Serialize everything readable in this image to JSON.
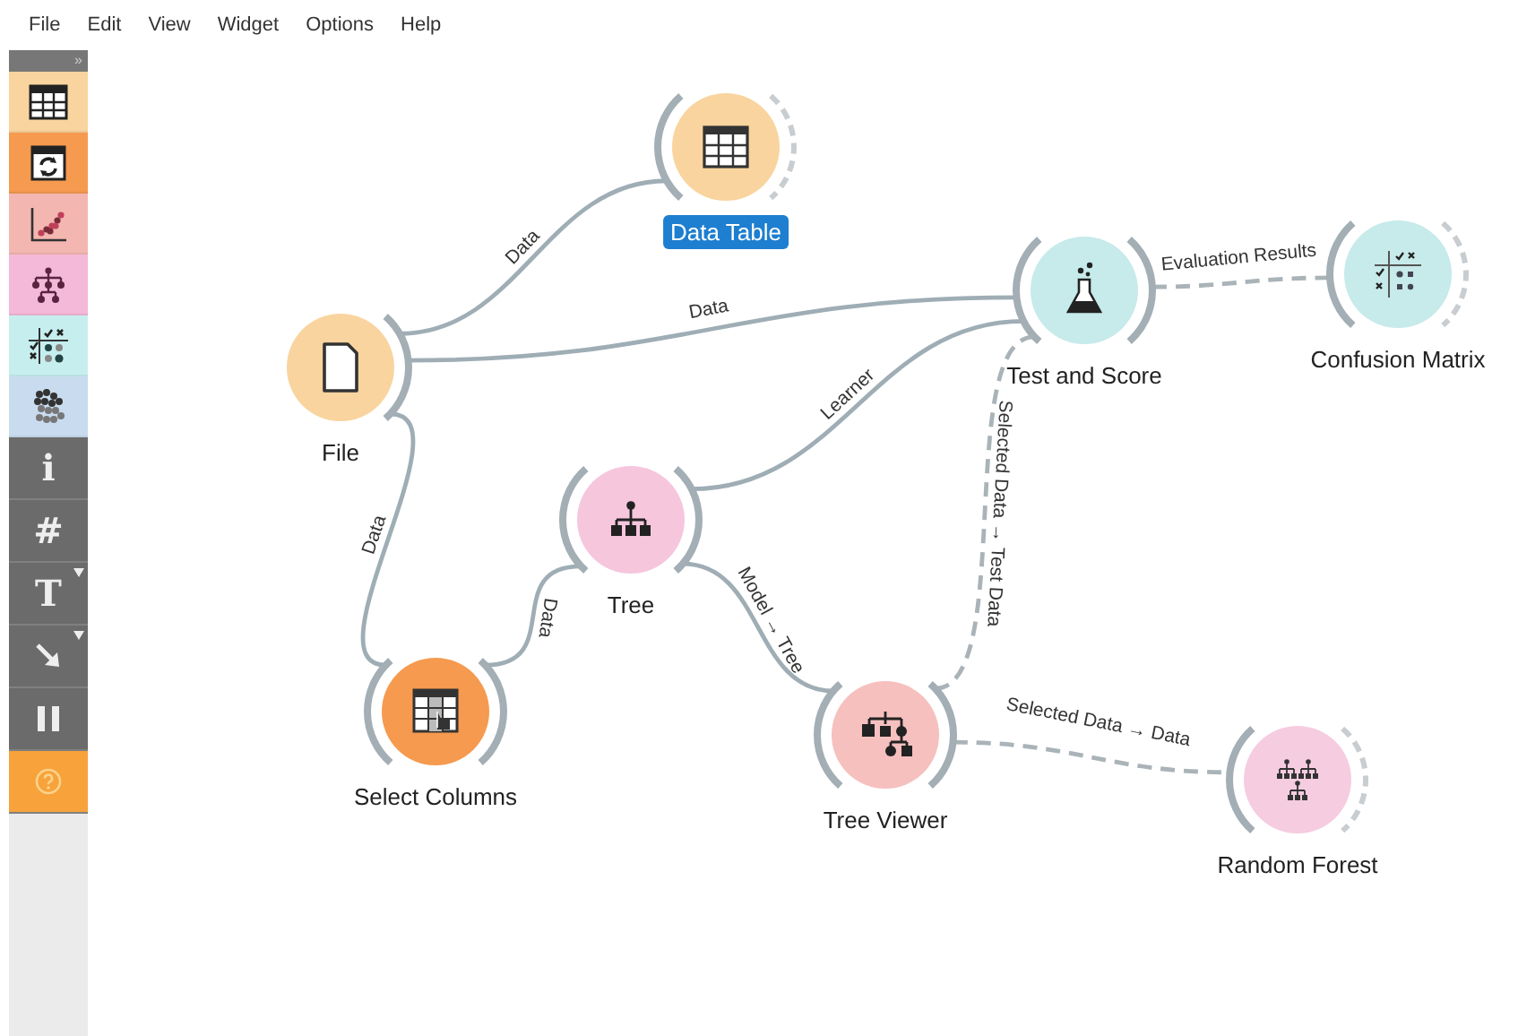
{
  "menu": [
    "File",
    "Edit",
    "View",
    "Widget",
    "Options",
    "Help"
  ],
  "toolbox": {
    "collapse": "»",
    "categories": [
      {
        "kind": "table",
        "color": "#f9d49e"
      },
      {
        "kind": "sync",
        "color": "#f59a4f"
      },
      {
        "kind": "scatter",
        "color": "#f3b6b0"
      },
      {
        "kind": "tree",
        "color": "#f4b8d8"
      },
      {
        "kind": "matrix",
        "color": "#c7eeee"
      },
      {
        "kind": "clusters",
        "color": "#c9dcef"
      }
    ],
    "tools": [
      {
        "kind": "text",
        "label": "i",
        "has_menu": false
      },
      {
        "kind": "text",
        "label": "#",
        "has_menu": false
      },
      {
        "kind": "text",
        "label": "T",
        "has_menu": true
      },
      {
        "kind": "arrow",
        "has_menu": true
      },
      {
        "kind": "pause",
        "has_menu": false
      },
      {
        "kind": "help",
        "has_menu": false
      }
    ]
  },
  "nodes": [
    {
      "title": "Data Table",
      "kind": "table",
      "color": "#f9d49e",
      "selected": true,
      "has_inputs": true
    },
    {
      "title": "File",
      "kind": "file",
      "color": "#f9d49e",
      "selected": false,
      "has_inputs": false
    },
    {
      "title": "Test and Score",
      "kind": "flask",
      "color": "#c7eaea",
      "selected": false,
      "has_inputs": true
    },
    {
      "title": "Confusion Matrix",
      "kind": "matrix",
      "color": "#c7eaea",
      "selected": false,
      "has_inputs": true
    },
    {
      "title": "Tree",
      "kind": "tree",
      "color": "#f6c6dd",
      "selected": false,
      "has_inputs": true
    },
    {
      "title": "Select Columns",
      "kind": "select",
      "color": "#f59a4f",
      "selected": false,
      "has_inputs": true
    },
    {
      "title": "Tree Viewer",
      "kind": "treeviewer",
      "color": "#f6c0bf",
      "selected": false,
      "has_inputs": true
    },
    {
      "title": "Random Forest",
      "kind": "forest",
      "color": "#f5cce0",
      "selected": false,
      "has_inputs": true
    }
  ],
  "links": [
    {
      "label": "Data",
      "dashed": false
    },
    {
      "label": "Data",
      "dashed": false
    },
    {
      "label": "Data",
      "dashed": false
    },
    {
      "label": "Data",
      "dashed": false
    },
    {
      "label": "Learner",
      "dashed": false
    },
    {
      "label": "Model → Tree",
      "dashed": false
    },
    {
      "label": "Selected Data → Test Data",
      "dashed": true
    },
    {
      "label": "Evaluation Results",
      "dashed": true
    },
    {
      "label": "Selected Data → Data",
      "dashed": true
    }
  ]
}
